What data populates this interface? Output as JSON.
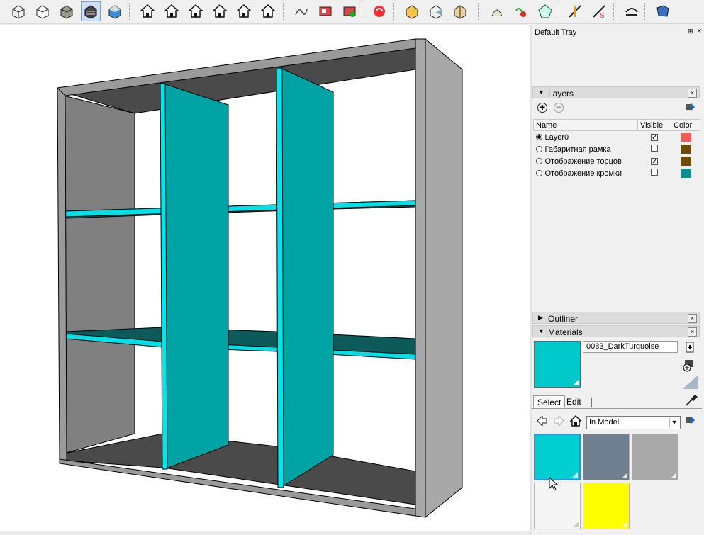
{
  "toolbar": {
    "buttons": [
      {
        "name": "xray-style-icon",
        "glyph": "box-outline",
        "active": false
      },
      {
        "name": "wireframe-style-icon",
        "glyph": "box-white",
        "active": false
      },
      {
        "name": "hidden-line-style-icon",
        "glyph": "box-grey",
        "active": false
      },
      {
        "name": "shaded-style-icon",
        "glyph": "box-dark",
        "active": true
      },
      {
        "name": "shaded-texture-style-icon",
        "glyph": "box-blue",
        "active": false
      },
      {
        "name": "iso-view-icon",
        "glyph": "house-iso",
        "active": false
      },
      {
        "name": "top-view-icon",
        "glyph": "house-top",
        "active": false
      },
      {
        "name": "front-view-icon",
        "glyph": "house",
        "active": false
      },
      {
        "name": "right-view-icon",
        "glyph": "house-right",
        "active": false
      },
      {
        "name": "back-view-icon",
        "glyph": "house-back",
        "active": false
      },
      {
        "name": "left-view-icon",
        "glyph": "house-left",
        "active": false
      },
      {
        "name": "sandbox-icon",
        "glyph": "curve",
        "active": false
      },
      {
        "name": "export-components-icon",
        "glyph": "red-box",
        "active": false
      },
      {
        "name": "import-components-icon",
        "glyph": "red-box-2",
        "active": false
      },
      {
        "name": "plugin-logo-icon",
        "glyph": "red-logo",
        "active": false
      },
      {
        "name": "solid-union-icon",
        "glyph": "solid-1",
        "active": false
      },
      {
        "name": "solid-subtract-icon",
        "glyph": "solid-2",
        "active": false
      },
      {
        "name": "solid-split-icon",
        "glyph": "solid-3",
        "active": false
      },
      {
        "name": "follow-me-icon",
        "glyph": "shell",
        "active": false
      },
      {
        "name": "geolocation-icon",
        "glyph": "pin",
        "active": false
      },
      {
        "name": "model-info-icon",
        "glyph": "gem",
        "active": false
      },
      {
        "name": "section-plane-icon",
        "glyph": "spark",
        "active": false
      },
      {
        "name": "section-display-icon",
        "glyph": "spark-s",
        "active": false
      },
      {
        "name": "bend-icon",
        "glyph": "arc",
        "active": false
      },
      {
        "name": "warehouse-icon",
        "glyph": "blue-cube",
        "active": false
      }
    ]
  },
  "tray": {
    "title": "Default Tray",
    "pin_glyph": "⊞",
    "close_glyph": "×",
    "layers": {
      "header": "Layers",
      "columns": [
        "Name",
        "Visible",
        "Color"
      ],
      "rows": [
        {
          "name": "Layer0",
          "active": true,
          "visible": true,
          "color": "#f15b5b"
        },
        {
          "name": "Габаритная рамка",
          "active": false,
          "visible": false,
          "color": "#6e4a05"
        },
        {
          "name": "Отображение торцов",
          "active": false,
          "visible": true,
          "color": "#6e4a05"
        },
        {
          "name": "Отображение кромки",
          "active": false,
          "visible": false,
          "color": "#0c8d8d"
        }
      ]
    },
    "outliner": {
      "header": "Outliner"
    },
    "materials": {
      "header": "Materials",
      "current_name": "0083_DarkTurquoise",
      "current_color": "#00c9cc",
      "tabs": [
        "Select",
        "Edit"
      ],
      "collection": "In Model",
      "swatches": [
        "#00ced1",
        "#708090",
        "#a9a9a9",
        "#f5f5f5",
        "#ffff00"
      ]
    }
  },
  "colors": {
    "teal": "#00a3a3",
    "teal_edge": "#00e5ee",
    "frame": "#9a9a9a",
    "inner_grey": "#808080",
    "dark_grey": "#4a4a4a"
  }
}
